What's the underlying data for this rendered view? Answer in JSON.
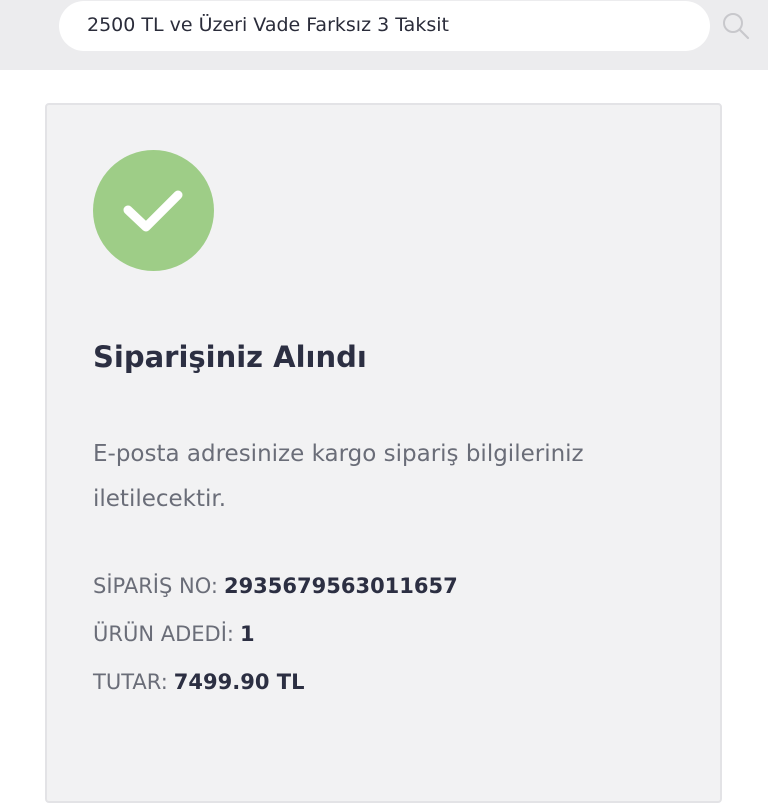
{
  "search": {
    "value": "2500 TL ve Üzeri Vade Farksız 3 Taksit",
    "icon": "search-icon"
  },
  "confirmation": {
    "icon": "check-icon",
    "icon_color": "#9ecd87",
    "title": "Siparişiniz Alındı",
    "message": "E-posta adresinize kargo sipariş bilgileriniz iletilecektir."
  },
  "order": {
    "number_label": "SİPARİŞ NO:",
    "number_value": "2935679563011657",
    "quantity_label": "ÜRÜN ADEDİ:",
    "quantity_value": "1",
    "total_label": "TUTAR:",
    "total_value": "7499.90 TL"
  }
}
